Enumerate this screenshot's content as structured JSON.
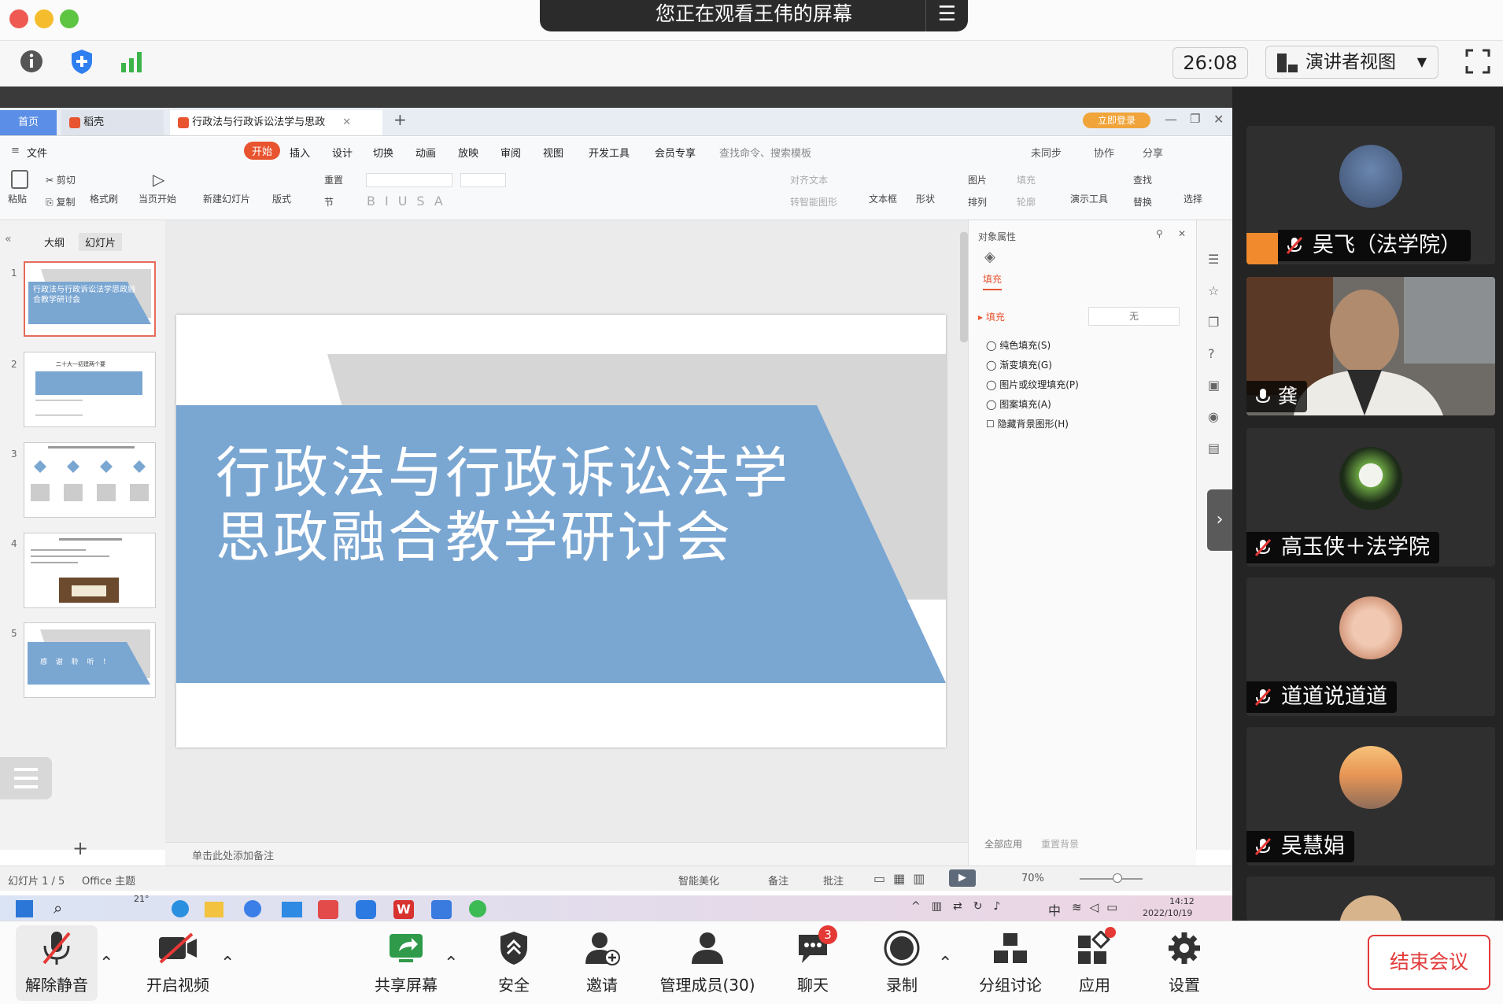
{
  "window": {
    "banner": "您正在观看王伟的屏幕",
    "timer": "26:08",
    "view_mode": "演讲者视图"
  },
  "wps": {
    "tabs": [
      "首页",
      "稻壳",
      "行政法与行政诉讼法学与思政"
    ],
    "login_badge": "立即登录",
    "menu": [
      "文件",
      "开始",
      "插入",
      "设计",
      "切换",
      "动画",
      "放映",
      "审阅",
      "视图",
      "开发工具",
      "会员专享"
    ],
    "search_placeholder": "查找命令、搜索模板",
    "menu_right": [
      "未同步",
      "协作",
      "分享"
    ],
    "ribbon": {
      "paste": "粘贴",
      "cut": "剪切",
      "copy": "复制",
      "format_painter": "格式刷",
      "from_current": "当页开始",
      "new_slide": "新建幻灯片",
      "layout": "版式",
      "reset": "重置",
      "section": "节",
      "align_text": "对齐文本",
      "smartart": "转智能图形",
      "textbox": "文本框",
      "shape": "形状",
      "picture": "图片",
      "fill": "填充",
      "arrange": "排列",
      "outline": "轮廓",
      "present_tools": "演示工具",
      "find": "查找",
      "replace": "替换",
      "select": "选择"
    },
    "left_panel": {
      "outline_tab": "大纲",
      "slides_tab": "幻灯片"
    },
    "slide_numbers": [
      "1",
      "2",
      "3",
      "4",
      "5"
    ],
    "thumb_texts": {
      "t1": "行政法与行政诉讼法学思政融合教学研讨会",
      "t2": "二十大一初建两个要",
      "t5": "感 谢 聆 听 ！"
    },
    "slide": {
      "title_line1": "行政法与行政诉讼法学",
      "title_line2": "思政融合教学研讨会"
    },
    "notes_placeholder": "单击此处添加备注",
    "props": {
      "header": "对象属性",
      "fill_tab": "填充",
      "fill_section": "填充",
      "fill_value": "无",
      "options": [
        "纯色填充(S)",
        "渐变填充(G)",
        "图片或纹理填充(P)",
        "图案填充(A)"
      ],
      "hide_bg": "隐藏背景图形(H)",
      "apply_all": "全部应用",
      "reset_bg": "重置背景"
    },
    "status": {
      "slide_count": "幻灯片 1 / 5",
      "theme": "Office 主题",
      "beautify": "智能美化",
      "notes": "备注",
      "comments": "批注",
      "zoom": "70%"
    },
    "taskbar": {
      "weather": "21°",
      "time": "14:12",
      "date": "2022/10/19",
      "ime": "中"
    }
  },
  "participants": [
    {
      "name": "吴飞（法学院）",
      "type": "avatar"
    },
    {
      "name": "龚",
      "type": "video"
    },
    {
      "name": "高玉侠＋法学院",
      "type": "avatar"
    },
    {
      "name": "道道说道道",
      "type": "avatar"
    },
    {
      "name": "吴慧娟",
      "type": "avatar"
    }
  ],
  "toolbar": {
    "unmute": "解除静音",
    "video": "开启视频",
    "share": "共享屏幕",
    "security": "安全",
    "invite": "邀请",
    "manage": "管理成员(30)",
    "chat": "聊天",
    "chat_badge": "3",
    "record": "录制",
    "breakout": "分组讨论",
    "apps": "应用",
    "settings": "设置",
    "end": "结束会议"
  },
  "colors": {
    "slide_blue": "#7aa6d2",
    "slide_gray": "#d6d6d6",
    "accent_red": "#e23b3b",
    "wps_orange": "#e8542f"
  }
}
